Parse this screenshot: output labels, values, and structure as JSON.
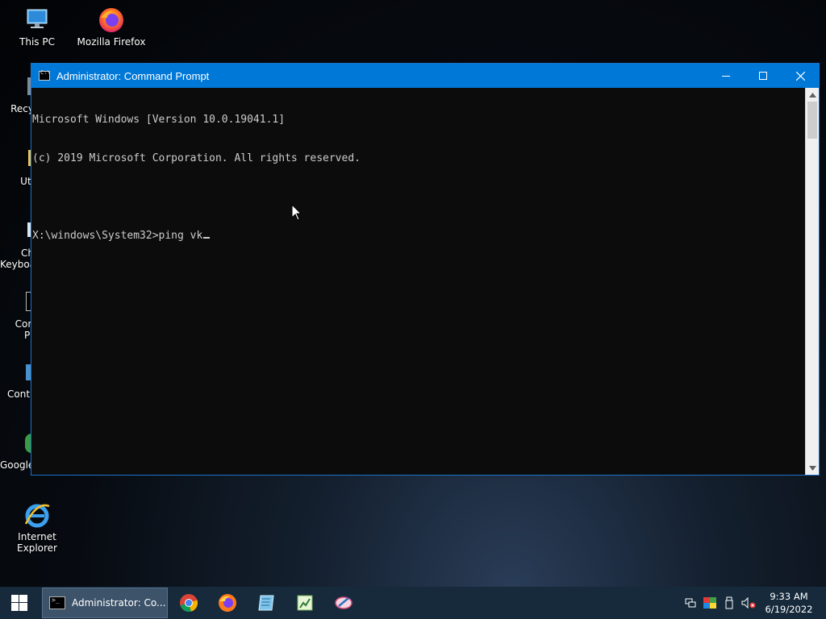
{
  "desktop": {
    "icons": [
      {
        "label": "This PC",
        "icon": "computer-icon"
      },
      {
        "label": "Mozilla Firefox",
        "icon": "firefox-icon"
      },
      {
        "label": "Internet Explorer",
        "icon": "internet-explorer-icon"
      }
    ],
    "partial_icons": [
      {
        "label": "Recy",
        "icon": "recycle-bin-icon"
      },
      {
        "label": "Uti",
        "icon": "folder-icon"
      },
      {
        "label": "Ch\nKeyboa",
        "icon": "keyboard-icon"
      },
      {
        "label": "Con\nPr",
        "icon": "command-prompt-icon"
      },
      {
        "label": "Contr",
        "icon": "control-panel-icon"
      },
      {
        "label": "Google",
        "icon": "chrome-icon"
      }
    ]
  },
  "window": {
    "title": "Administrator: Command Prompt",
    "console_lines": [
      "Microsoft Windows [Version 10.0.19041.1]",
      "(c) 2019 Microsoft Corporation. All rights reserved.",
      "",
      "X:\\windows\\System32>ping vk"
    ]
  },
  "taskbar": {
    "active_task_label": "Administrator: Co...",
    "pinned": [
      "chrome-icon",
      "firefox-icon",
      "notepad-icon",
      "spreadsheet-icon",
      "paint-icon"
    ],
    "tray_icons": [
      "network-icon",
      "display-icon",
      "usb-icon",
      "volume-muted-icon"
    ],
    "time": "9:33 AM",
    "date": "6/19/2022"
  },
  "colors": {
    "titlebar": "#0078d7",
    "console_bg": "#0c0c0c",
    "console_text": "#cccccc",
    "taskbar": "#162a3c"
  }
}
